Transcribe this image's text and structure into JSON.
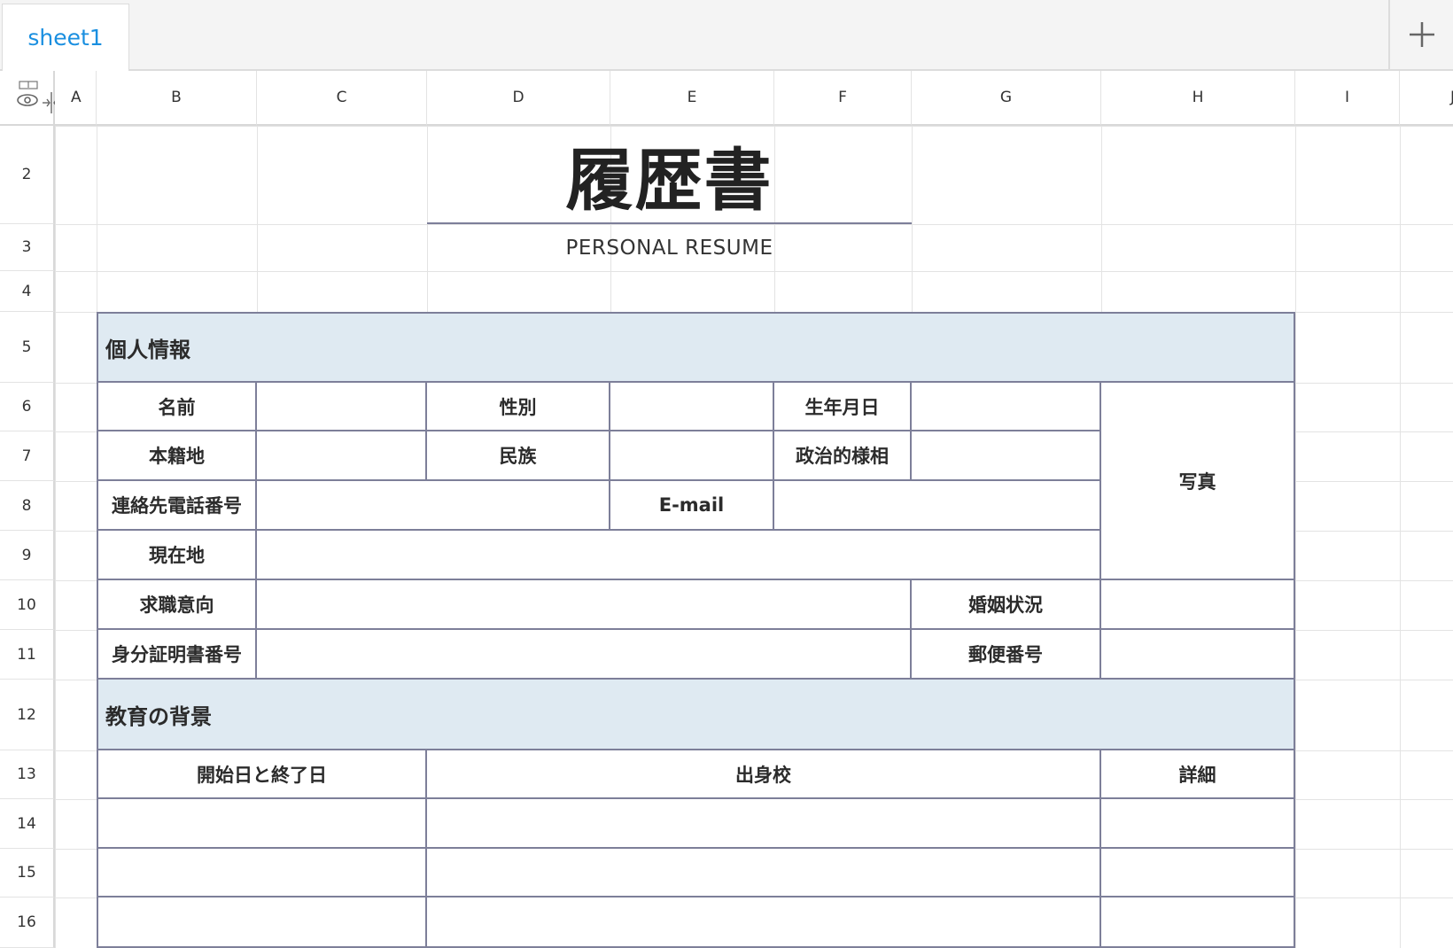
{
  "tabs": {
    "active_sheet": "sheet1",
    "add_icon": "plus-icon"
  },
  "columns": [
    "A",
    "B",
    "C",
    "D",
    "E",
    "F",
    "G",
    "H",
    "I",
    "J"
  ],
  "rows": [
    "2",
    "3",
    "4",
    "5",
    "6",
    "7",
    "8",
    "9",
    "10",
    "11",
    "12",
    "13",
    "14",
    "15",
    "16"
  ],
  "header_icons": [
    "eye-icon",
    "collapse-columns-icon"
  ],
  "resume": {
    "title": "履歴書",
    "subtitle": "PERSONAL RESUME",
    "section_personal": "個人情報",
    "name": "名前",
    "gender": "性別",
    "birthdate": "生年月日",
    "domicile": "本籍地",
    "ethnicity": "民族",
    "political": "政治的様相",
    "phone": "連絡先電話番号",
    "email": "E-mail",
    "photo": "写真",
    "address": "現在地",
    "job_intention": "求職意向",
    "marital": "婚姻状況",
    "id_number": "身分証明書番号",
    "postal": "郵便番号",
    "section_education": "教育の背景",
    "period": "開始日と終了日",
    "school": "出身校",
    "details": "詳細"
  }
}
